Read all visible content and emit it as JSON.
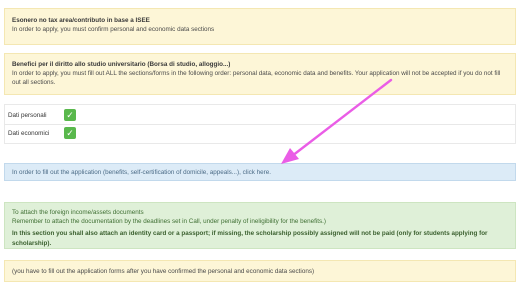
{
  "isee": {
    "title": "Esonero no tax area/contributo in base a ISEE",
    "text": "In order to apply, you must confirm personal and economic data sections"
  },
  "benefits": {
    "title": "Benefici per il diritto allo studio universitario (Borsa di studio, alloggio...)",
    "text": "In order to apply, you must fill out ALL the sections/forms in the following order: personal data, economic data and benefits. Your application will not be accepted if you do not fill out all sections."
  },
  "sections": [
    {
      "label": "Dati personali",
      "status_icon": "check-icon",
      "status_color": "#59b84c"
    },
    {
      "label": "Dati economici",
      "status_icon": "check-icon",
      "status_color": "#59b84c"
    }
  ],
  "application_notice": {
    "text": "In order to fill out the application (benefits, self-certification of domicile, appeals...), click here."
  },
  "foreign_docs": {
    "line1": "To attach the foreign income/assets documents",
    "line2": "Remember to attach the documentation by the deadlines set in Call, under penalty of ineligibility for the benefits.)",
    "line3": "In this section you shall also attach an identity card or a passport; if missing, the scholarship possibly assigned will not be paid (only for students applying for scholarship)."
  },
  "footer_notice": {
    "text": "(you have to fill out the application forms after you have confirmed the personal and economic data sections)"
  },
  "colors": {
    "annotation_arrow": "#ea5de6"
  }
}
